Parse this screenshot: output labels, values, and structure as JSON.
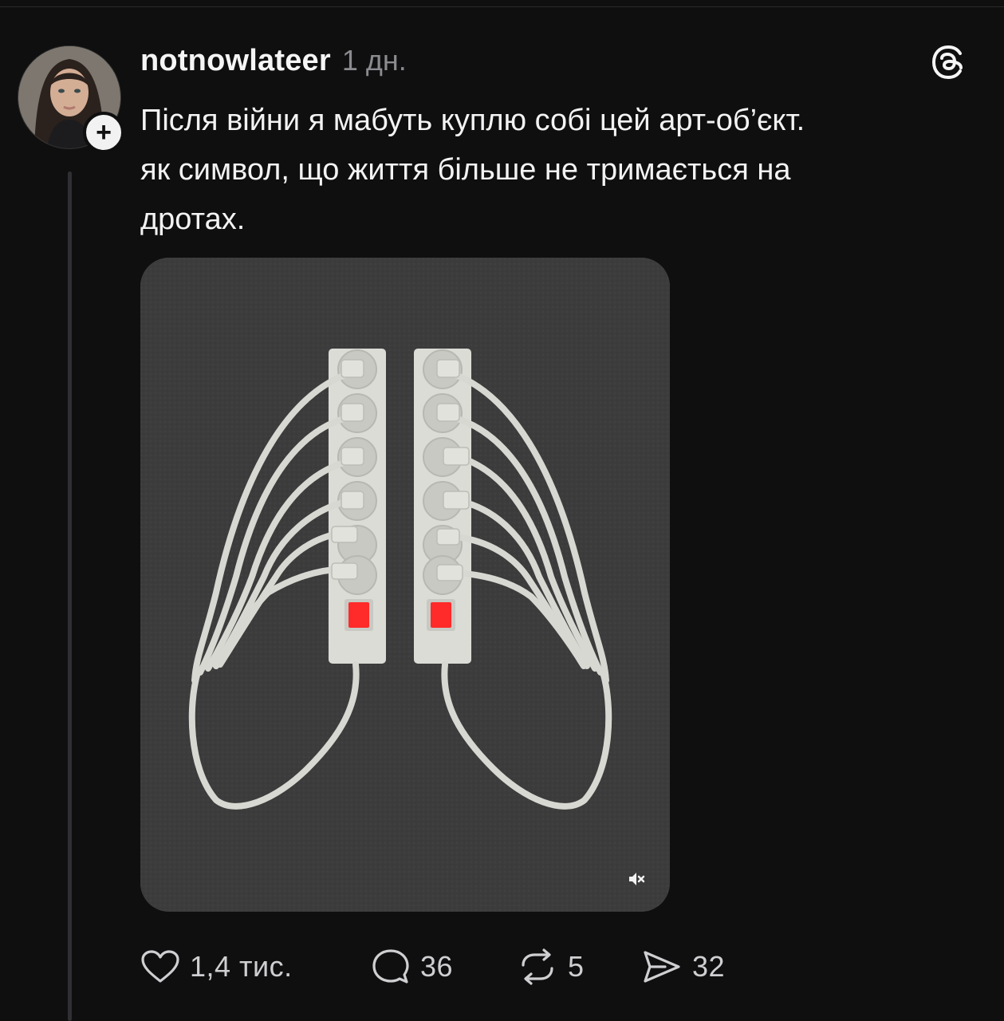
{
  "post": {
    "username": "notnowlateer",
    "time": "1 дн.",
    "lines": [
      "Після війни я мабуть куплю собі цей арт-об’єкт.",
      "як символ, що життя більше не тримається на",
      "дротах."
    ]
  },
  "actions": {
    "likes": "1,4 тис.",
    "replies": "36",
    "reposts": "5",
    "shares": "32"
  },
  "icons": {
    "avatar": "avatar",
    "follow": "plus-icon",
    "logo": "threads-logo-icon",
    "like": "heart-icon",
    "reply": "comment-icon",
    "repost": "repost-icon",
    "share": "send-icon",
    "mute": "mute-icon"
  },
  "colors": {
    "background": "#0f0f10",
    "text": "#f3f3f3",
    "muted": "#8b8b8f",
    "switch_red": "#ff2a2a"
  }
}
